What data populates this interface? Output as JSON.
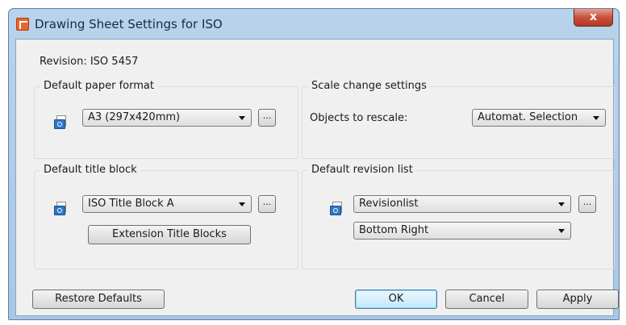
{
  "window": {
    "title": "Drawing Sheet Settings for ISO",
    "close_glyph": "x"
  },
  "revision": {
    "text": "Revision: ISO 5457"
  },
  "paper_format": {
    "group_title": "Default paper format",
    "selected": "A3 (297x420mm)",
    "browse_label": "...",
    "icon": "drawing-sheet-icon"
  },
  "scale": {
    "group_title": "Scale change settings",
    "objects_label": "Objects to rescale:",
    "selected": "Automat. Selection"
  },
  "title_block": {
    "group_title": "Default title block",
    "selected": "ISO Title Block A",
    "browse_label": "...",
    "extension_button": "Extension Title Blocks",
    "icon": "drawing-sheet-icon"
  },
  "revision_list": {
    "group_title": "Default revision list",
    "selected": "Revisionlist",
    "browse_label": "...",
    "position_selected": "Bottom Right",
    "icon": "drawing-sheet-icon"
  },
  "footer": {
    "restore_label": "Restore Defaults",
    "ok_label": "OK",
    "cancel_label": "Cancel",
    "apply_label": "Apply"
  }
}
